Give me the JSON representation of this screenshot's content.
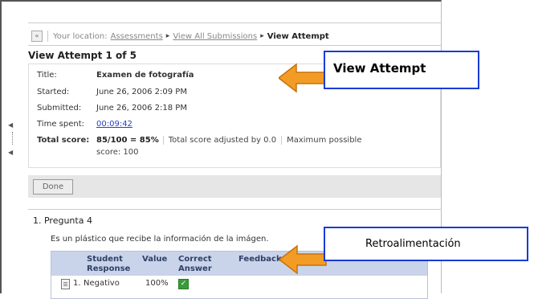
{
  "breadcrumb": {
    "prefix": "Your location:",
    "items": [
      "Assessments",
      "View All Submissions"
    ],
    "current": "View Attempt"
  },
  "attempt": {
    "heading": "View Attempt 1 of 5",
    "title_label": "Title:",
    "title_value": "Examen de fotografía",
    "started_label": "Started:",
    "started_value": "June 26, 2006 2:09 PM",
    "submitted_label": "Submitted:",
    "submitted_value": "June 26, 2006 2:18 PM",
    "timespent_label": "Time spent:",
    "timespent_value": "00:09:42",
    "total_label": "Total score:",
    "total_value": "85/100 = 85%",
    "adjusted": "Total score adjusted by 0.0",
    "maximum_1": "Maximum possible",
    "maximum_2": "score: 100"
  },
  "done_label": "Done",
  "question": {
    "title": "1.  Pregunta 4",
    "text": "Es un plástico que recibe la información de la imágen.",
    "headers": {
      "student": [
        "Student",
        "Response"
      ],
      "value": "Value",
      "correct": [
        "Correct",
        "Answer"
      ],
      "feedback": "Feedback"
    },
    "rows": [
      {
        "index": "1.",
        "response": "Negativo",
        "value": "100%"
      }
    ]
  },
  "callouts": {
    "one": "View Attempt",
    "two": "Retroalimentación"
  },
  "colors": {
    "callout_border": "#1a3bd6",
    "arrow_fill": "#f39c25",
    "table_header": "#c9d4ea",
    "link": "#2a3fbf"
  },
  "icons": [
    "back-arrow-icon",
    "document-icon",
    "check-icon",
    "collapse-arrow-icon"
  ]
}
